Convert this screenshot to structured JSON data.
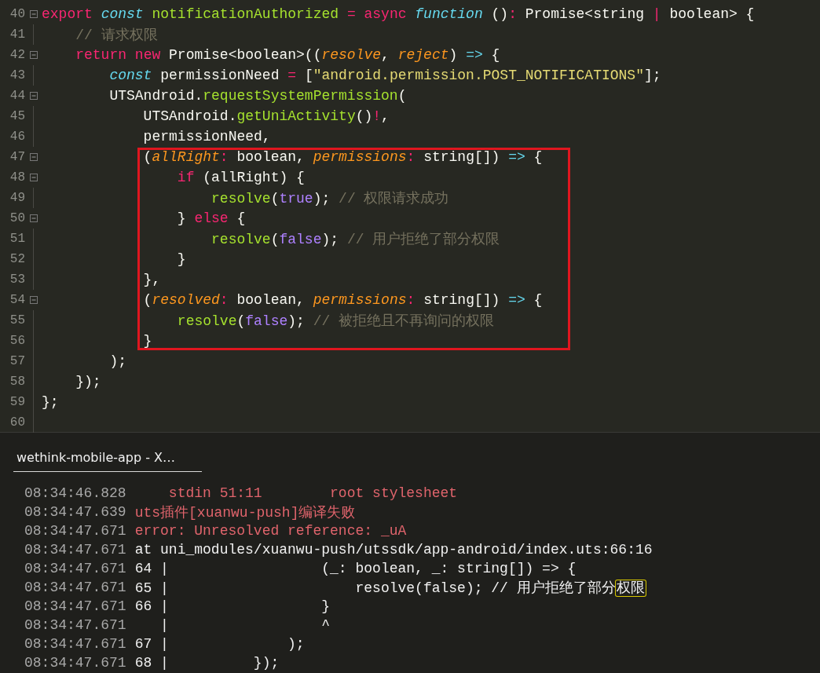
{
  "editor": {
    "blocks": [
      {
        "kind": "plain",
        "lines": [
          {
            "number": "40",
            "fold": true,
            "tokens": [
              {
                "text": "export ",
                "kind": "keyword"
              },
              {
                "text": "const ",
                "kind": "storage"
              },
              {
                "text": "notificationAuthorized ",
                "kind": "function"
              },
              {
                "text": "= ",
                "kind": "keyword"
              },
              {
                "text": "async ",
                "kind": "keyword"
              },
              {
                "text": "function",
                "kind": "storage"
              },
              {
                "text": " ()",
                "kind": "plain"
              },
              {
                "text": ":",
                "kind": "keyword"
              },
              {
                "text": " Promise<string ",
                "kind": "plain"
              },
              {
                "text": "|",
                "kind": "keyword"
              },
              {
                "text": " boolean> {",
                "kind": "plain"
              }
            ]
          },
          {
            "number": "41",
            "fold": false,
            "tokens": [
              {
                "text": "    // 请求权限",
                "kind": "comment"
              }
            ]
          },
          {
            "number": "42",
            "fold": true,
            "tokens": [
              {
                "text": "    return ",
                "kind": "keyword"
              },
              {
                "text": "new",
                "kind": "keyword"
              },
              {
                "text": " Promise<boolean>((",
                "kind": "plain"
              },
              {
                "text": "resolve",
                "kind": "param"
              },
              {
                "text": ", ",
                "kind": "plain"
              },
              {
                "text": "reject",
                "kind": "param"
              },
              {
                "text": ") ",
                "kind": "plain"
              },
              {
                "text": "=>",
                "kind": "operator"
              },
              {
                "text": " {",
                "kind": "plain"
              }
            ]
          },
          {
            "number": "43",
            "fold": false,
            "tokens": [
              {
                "text": "        const",
                "kind": "storage"
              },
              {
                "text": " permissionNeed ",
                "kind": "plain"
              },
              {
                "text": "=",
                "kind": "keyword"
              },
              {
                "text": " [",
                "kind": "plain"
              },
              {
                "text": "\"android.permission.POST_NOTIFICATIONS\"",
                "kind": "string"
              },
              {
                "text": "];",
                "kind": "plain"
              }
            ]
          },
          {
            "number": "44",
            "fold": true,
            "tokens": [
              {
                "text": "        UTSAndroid.",
                "kind": "plain"
              },
              {
                "text": "requestSystemPermission",
                "kind": "function"
              },
              {
                "text": "(",
                "kind": "plain"
              }
            ]
          },
          {
            "number": "45",
            "fold": false,
            "tokens": [
              {
                "text": "            UTSAndroid.",
                "kind": "plain"
              },
              {
                "text": "getUniActivity",
                "kind": "function"
              },
              {
                "text": "()",
                "kind": "plain"
              },
              {
                "text": "!",
                "kind": "keyword"
              },
              {
                "text": ",",
                "kind": "plain"
              }
            ]
          },
          {
            "number": "46",
            "fold": false,
            "tokens": [
              {
                "text": "            permissionNeed,",
                "kind": "plain"
              }
            ]
          }
        ]
      },
      {
        "kind": "highlight",
        "lines": [
          {
            "number": "47",
            "fold": true,
            "tokens": [
              {
                "text": "            (",
                "kind": "plain"
              },
              {
                "text": "allRight",
                "kind": "param"
              },
              {
                "text": ":",
                "kind": "keyword"
              },
              {
                "text": " boolean, ",
                "kind": "plain"
              },
              {
                "text": "permissions",
                "kind": "param"
              },
              {
                "text": ":",
                "kind": "keyword"
              },
              {
                "text": " string[]) ",
                "kind": "plain"
              },
              {
                "text": "=>",
                "kind": "operator"
              },
              {
                "text": " {",
                "kind": "plain"
              }
            ]
          },
          {
            "number": "48",
            "fold": true,
            "tokens": [
              {
                "text": "                if",
                "kind": "keyword"
              },
              {
                "text": " (allRight) {",
                "kind": "plain"
              }
            ]
          },
          {
            "number": "49",
            "fold": false,
            "tokens": [
              {
                "text": "                    resolve",
                "kind": "function"
              },
              {
                "text": "(",
                "kind": "plain"
              },
              {
                "text": "true",
                "kind": "constant"
              },
              {
                "text": "); ",
                "kind": "plain"
              },
              {
                "text": "// 权限请求成功",
                "kind": "comment"
              }
            ]
          },
          {
            "number": "50",
            "fold": true,
            "tokens": [
              {
                "text": "                } ",
                "kind": "plain"
              },
              {
                "text": "else",
                "kind": "keyword"
              },
              {
                "text": " {",
                "kind": "plain"
              }
            ]
          },
          {
            "number": "51",
            "fold": false,
            "tokens": [
              {
                "text": "                    resolve",
                "kind": "function"
              },
              {
                "text": "(",
                "kind": "plain"
              },
              {
                "text": "false",
                "kind": "constant"
              },
              {
                "text": "); ",
                "kind": "plain"
              },
              {
                "text": "// 用户拒绝了部分权限",
                "kind": "comment"
              }
            ]
          },
          {
            "number": "52",
            "fold": false,
            "tokens": [
              {
                "text": "                }",
                "kind": "plain"
              }
            ]
          },
          {
            "number": "53",
            "fold": false,
            "tokens": [
              {
                "text": "            },",
                "kind": "plain"
              }
            ]
          },
          {
            "number": "54",
            "fold": true,
            "tokens": [
              {
                "text": "            (",
                "kind": "plain"
              },
              {
                "text": "resolved",
                "kind": "param"
              },
              {
                "text": ":",
                "kind": "keyword"
              },
              {
                "text": " boolean, ",
                "kind": "plain"
              },
              {
                "text": "permissions",
                "kind": "param"
              },
              {
                "text": ":",
                "kind": "keyword"
              },
              {
                "text": " string[]) ",
                "kind": "plain"
              },
              {
                "text": "=>",
                "kind": "operator"
              },
              {
                "text": " {",
                "kind": "plain"
              }
            ]
          },
          {
            "number": "55",
            "fold": false,
            "tokens": [
              {
                "text": "                resolve",
                "kind": "function"
              },
              {
                "text": "(",
                "kind": "plain"
              },
              {
                "text": "false",
                "kind": "constant"
              },
              {
                "text": "); ",
                "kind": "plain"
              },
              {
                "text": "// 被拒绝且不再询问的权限",
                "kind": "comment"
              }
            ]
          },
          {
            "number": "56",
            "fold": false,
            "tokens": [
              {
                "text": "            }",
                "kind": "plain"
              }
            ]
          }
        ]
      },
      {
        "kind": "plain",
        "lines": [
          {
            "number": "57",
            "fold": false,
            "tokens": [
              {
                "text": "        );",
                "kind": "plain"
              }
            ]
          },
          {
            "number": "58",
            "fold": false,
            "tokens": [
              {
                "text": "    });",
                "kind": "plain"
              }
            ]
          },
          {
            "number": "59",
            "fold": false,
            "tokens": [
              {
                "text": "};",
                "kind": "plain"
              }
            ]
          },
          {
            "number": "60",
            "fold": false
          }
        ]
      }
    ]
  },
  "console": {
    "tab": {
      "label": "wethink-mobile-app - X…",
      "selected": true
    },
    "lines": [
      {
        "time": "08:34:46.828",
        "segments": [
          {
            "text": "    stdin 51:11        root stylesheet",
            "kind": "error",
            "match": false
          }
        ]
      },
      {
        "time": "08:34:47.639",
        "segments": [
          {
            "text": "uts插件[xuanwu-push]编译失败",
            "kind": "error",
            "match": false
          }
        ]
      },
      {
        "time": "08:34:47.671",
        "segments": [
          {
            "text": "error: Unresolved reference: _uA",
            "kind": "error",
            "match": false
          }
        ]
      },
      {
        "time": "08:34:47.671",
        "segments": [
          {
            "text": "at uni_modules/xuanwu-push/utssdk/app-android/index.uts:66:16",
            "kind": "plain",
            "match": false
          }
        ]
      },
      {
        "time": "08:34:47.671",
        "segments": [
          {
            "text": "64 |                  (_: boolean, _: string[]) => {",
            "kind": "plain",
            "match": false
          }
        ]
      },
      {
        "time": "08:34:47.671",
        "segments": [
          {
            "text": "65 |                      resolve(false); // 用户拒绝了部分",
            "kind": "plain",
            "match": false
          },
          {
            "text": "权限",
            "kind": "plain",
            "match": true
          }
        ]
      },
      {
        "time": "08:34:47.671",
        "segments": [
          {
            "text": "66 |                  }",
            "kind": "plain",
            "match": false
          }
        ]
      },
      {
        "time": "08:34:47.671",
        "segments": [
          {
            "text": "   |                  ^",
            "kind": "plain",
            "match": false
          }
        ]
      },
      {
        "time": "08:34:47.671",
        "segments": [
          {
            "text": "67 |              );",
            "kind": "plain",
            "match": false
          }
        ]
      },
      {
        "time": "08:34:47.671",
        "segments": [
          {
            "text": "68 |          });",
            "kind": "plain",
            "match": false
          }
        ]
      }
    ]
  }
}
